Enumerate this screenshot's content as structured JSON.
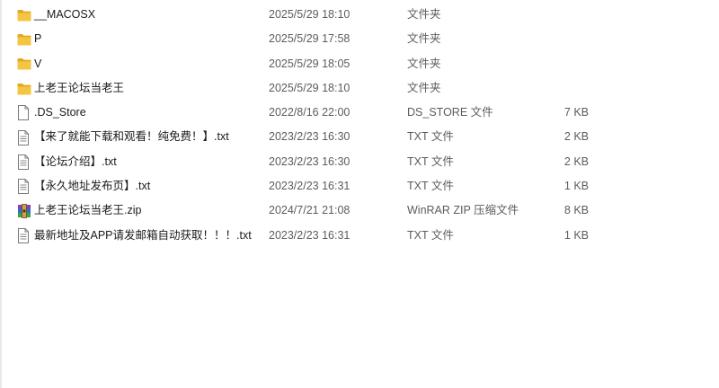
{
  "files": [
    {
      "name": "__MACOSX",
      "date": "2025/5/29 18:10",
      "type": "文件夹",
      "size": "",
      "icon": "folder-icon"
    },
    {
      "name": "P",
      "date": "2025/5/29 17:58",
      "type": "文件夹",
      "size": "",
      "icon": "folder-icon"
    },
    {
      "name": "V",
      "date": "2025/5/29 18:05",
      "type": "文件夹",
      "size": "",
      "icon": "folder-icon"
    },
    {
      "name": "上老王论坛当老王",
      "date": "2025/5/29 18:10",
      "type": "文件夹",
      "size": "",
      "icon": "folder-icon"
    },
    {
      "name": ".DS_Store",
      "date": "2022/8/16 22:00",
      "type": "DS_STORE 文件",
      "size": "7 KB",
      "icon": "file-icon"
    },
    {
      "name": "【来了就能下载和观看！纯免费！】.txt",
      "date": "2023/2/23 16:30",
      "type": "TXT 文件",
      "size": "2 KB",
      "icon": "text-file-icon"
    },
    {
      "name": "【论坛介绍】.txt",
      "date": "2023/2/23 16:30",
      "type": "TXT 文件",
      "size": "2 KB",
      "icon": "text-file-icon"
    },
    {
      "name": "【永久地址发布页】.txt",
      "date": "2023/2/23 16:31",
      "type": "TXT 文件",
      "size": "1 KB",
      "icon": "text-file-icon"
    },
    {
      "name": "上老王论坛当老王.zip",
      "date": "2024/7/21 21:08",
      "type": "WinRAR ZIP 压缩文件",
      "size": "8 KB",
      "icon": "winrar-archive-icon"
    },
    {
      "name": "最新地址及APP请发邮箱自动获取！！！.txt",
      "date": "2023/2/23 16:31",
      "type": "TXT 文件",
      "size": "1 KB",
      "icon": "text-file-icon"
    }
  ],
  "colors": {
    "folder": "#f4c542",
    "folder_dark": "#e0a823",
    "file_outline": "#7a7a7a"
  }
}
